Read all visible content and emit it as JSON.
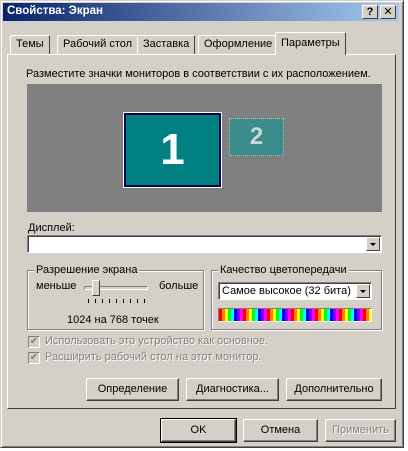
{
  "window": {
    "title": "Свойства: Экран",
    "help_glyph": "?",
    "close_glyph": "✕"
  },
  "tabs": [
    {
      "label": "Темы"
    },
    {
      "label": "Рабочий стол"
    },
    {
      "label": "Заставка"
    },
    {
      "label": "Оформление"
    },
    {
      "label": "Параметры",
      "active": true
    }
  ],
  "settings": {
    "instruction": "Разместите значки мониторов в соответствии с их расположением.",
    "monitors": [
      {
        "number": "1",
        "selected": true
      },
      {
        "number": "2",
        "selected": false
      }
    ],
    "display_label": "Дисплей:",
    "display_value": "",
    "resolution": {
      "title": "Разрешение экрана",
      "less_label": "меньше",
      "more_label": "больше",
      "value_text": "1024 на 768 точек",
      "slider_position": 0.15
    },
    "color_quality": {
      "title": "Качество цветопередачи",
      "selected": "Самое высокое (32 бита)"
    },
    "checkboxes": [
      {
        "label": "Использовать это устройство как основное.",
        "checked": true,
        "enabled": false
      },
      {
        "label": "Расширить рабочий стол на этот монитор.",
        "checked": true,
        "enabled": false
      }
    ],
    "buttons": {
      "identify": "Определение",
      "troubleshoot": "Диагностика...",
      "advanced": "Дополнительно"
    }
  },
  "dialog_buttons": {
    "ok": "OK",
    "cancel": "Отмена",
    "apply": "Применить"
  },
  "colors": {
    "face": "#d4d0c8",
    "title_start": "#0a246a",
    "title_end": "#a6caf0",
    "monitor_area": "#808080",
    "monitor_fill": "#008080"
  }
}
